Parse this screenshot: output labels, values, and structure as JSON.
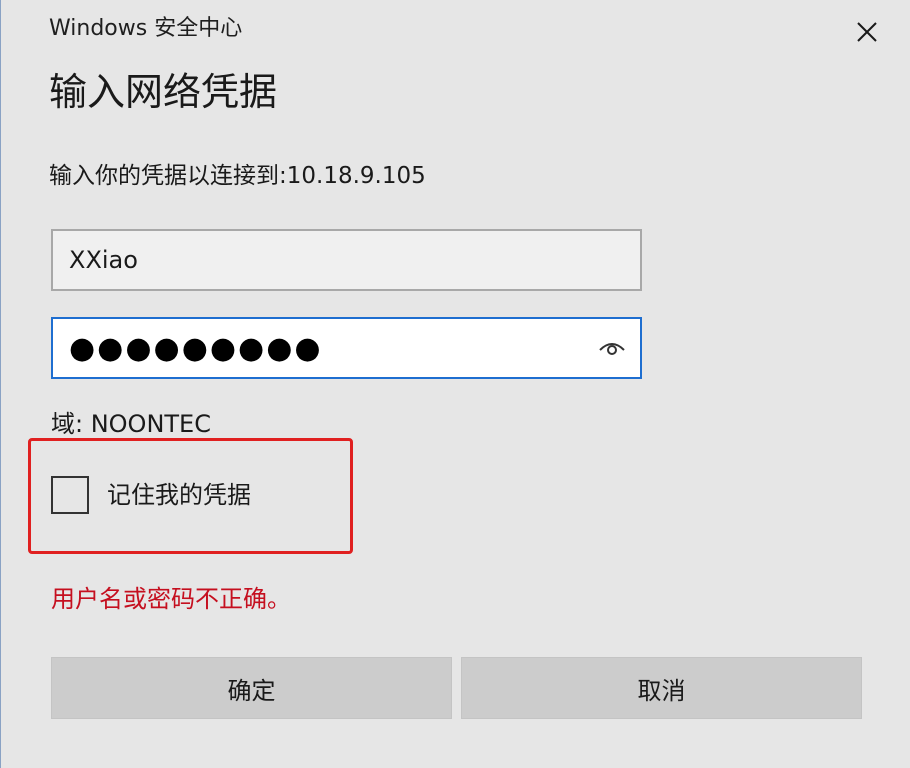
{
  "window": {
    "app_title": "Windows 安全中心"
  },
  "dialog": {
    "heading": "输入网络凭据",
    "prompt": "输入你的凭据以连接到:10.18.9.105",
    "username_value": "XXiao",
    "password_mask": "●●●●●●●●●",
    "domain_text": "域: NOONTEC",
    "remember_label": "记住我的凭据",
    "remember_checked": false,
    "error_message": "用户名或密码不正确。",
    "ok_label": "确定",
    "cancel_label": "取消"
  },
  "icons": {
    "close": "close-icon",
    "reveal_password": "eye-icon"
  },
  "colors": {
    "background": "#e6e6e6",
    "focus_border": "#1e6ed0",
    "error_text": "#c50f1f",
    "highlight_border": "#e02020",
    "button_bg": "#cccccc"
  }
}
